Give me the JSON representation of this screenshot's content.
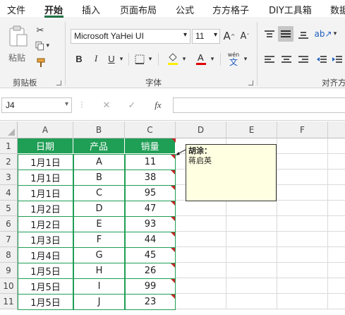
{
  "tabs": [
    "文件",
    "开始",
    "插入",
    "页面布局",
    "公式",
    "方方格子",
    "DIY工具箱",
    "数据"
  ],
  "active_tab": "开始",
  "ribbon": {
    "clipboard": {
      "paste_label": "粘贴",
      "group_label": "剪贴板"
    },
    "font": {
      "font_name": "Microsoft YaHei UI",
      "font_size": "11",
      "group_label": "字体",
      "bold": "B",
      "italic": "I",
      "underline": "U",
      "wen": "wén",
      "wen_char": "文"
    },
    "align": {
      "group_label": "对齐方"
    }
  },
  "formula_bar": {
    "name_box": "J4",
    "fx": "fx",
    "cancel": "✕",
    "enter": "✓",
    "formula": ""
  },
  "columns": [
    "A",
    "B",
    "C",
    "D",
    "E",
    "F"
  ],
  "rows": [
    "1",
    "2",
    "3",
    "4",
    "5",
    "6",
    "7",
    "8",
    "9",
    "10",
    "11"
  ],
  "table": {
    "headers": [
      "日期",
      "产品",
      "销量"
    ],
    "rows": [
      [
        "1月1日",
        "A",
        "11"
      ],
      [
        "1月1日",
        "B",
        "38"
      ],
      [
        "1月1日",
        "C",
        "95"
      ],
      [
        "1月2日",
        "D",
        "47"
      ],
      [
        "1月2日",
        "E",
        "93"
      ],
      [
        "1月3日",
        "F",
        "44"
      ],
      [
        "1月4日",
        "G",
        "45"
      ],
      [
        "1月5日",
        "H",
        "26"
      ],
      [
        "1月5日",
        "I",
        "99"
      ],
      [
        "1月5日",
        "J",
        "23"
      ]
    ]
  },
  "comment": {
    "author": "胡涂：",
    "text": "蒋启英"
  },
  "colors": {
    "excel_green": "#217346",
    "header_fill": "#1f9e55",
    "comment_bg": "#ffffe1",
    "comment_flag": "#c62828"
  }
}
